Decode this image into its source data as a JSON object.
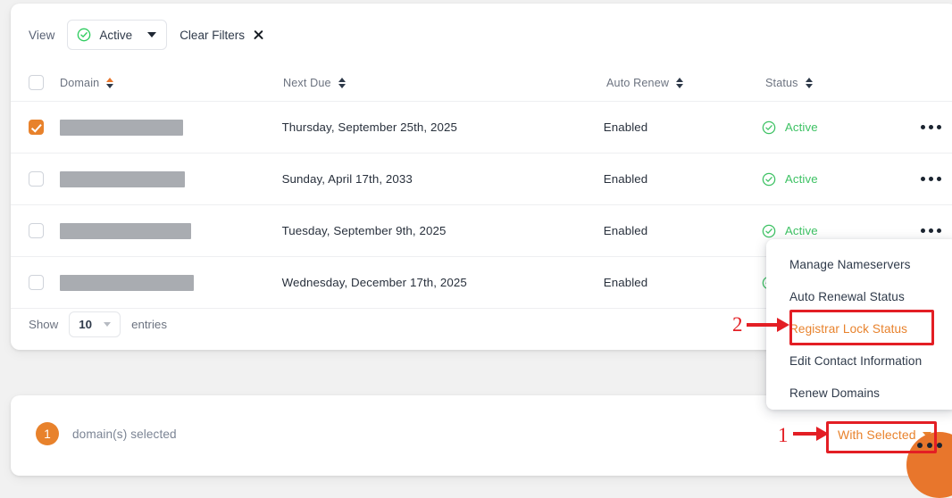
{
  "filters": {
    "view_label": "View",
    "active_filter": "Active",
    "clear_filters": "Clear Filters"
  },
  "table": {
    "columns": [
      {
        "label": "Domain",
        "sorted": true
      },
      {
        "label": "Next Due",
        "sorted": false
      },
      {
        "label": "Auto Renew",
        "sorted": false
      },
      {
        "label": "Status",
        "sorted": false
      }
    ],
    "rows": [
      {
        "checked": true,
        "domain_width": 138,
        "next_due": "Thursday, September 25th, 2025",
        "auto_renew": "Enabled",
        "status": "Active"
      },
      {
        "checked": false,
        "domain_width": 140,
        "next_due": "Sunday, April 17th, 2033",
        "auto_renew": "Enabled",
        "status": "Active"
      },
      {
        "checked": false,
        "domain_width": 147,
        "next_due": "Tuesday, September 9th, 2025",
        "auto_renew": "Enabled",
        "status": "Active"
      },
      {
        "checked": false,
        "domain_width": 150,
        "next_due": "Wednesday, December 17th, 2025",
        "auto_renew": "Enabled",
        "status": "Active"
      }
    ]
  },
  "footer": {
    "show_label": "Show",
    "entries_value": "10",
    "entries_label": "entries"
  },
  "selection": {
    "count": "1",
    "text": "domain(s) selected",
    "with_selected_label": "With Selected"
  },
  "dropdown": {
    "items": [
      {
        "label": "Manage Nameservers",
        "highlighted": false
      },
      {
        "label": "Auto Renewal Status",
        "highlighted": false
      },
      {
        "label": "Registrar Lock Status",
        "highlighted": true
      },
      {
        "label": "Edit Contact Information",
        "highlighted": false
      },
      {
        "label": "Renew Domains",
        "highlighted": false
      }
    ]
  },
  "annotations": {
    "step_one": "1",
    "step_two": "2"
  },
  "colors": {
    "accent_orange": "#e8822c",
    "status_green": "#3ec264",
    "annotation_red": "#e31e24",
    "page_background": "#f1f1f1"
  }
}
